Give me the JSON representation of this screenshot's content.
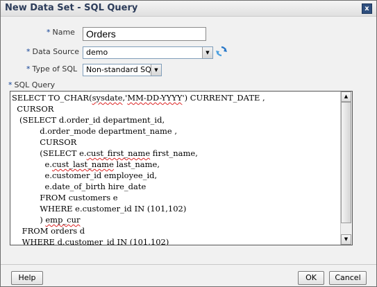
{
  "dialog": {
    "title": "New Data Set - SQL Query",
    "close_label": "x"
  },
  "form": {
    "name": {
      "label": "Name",
      "value": "Orders"
    },
    "data_source": {
      "label": "Data Source",
      "value": "demo"
    },
    "type_of_sql": {
      "label": "Type of SQL",
      "value": "Non-standard SQL"
    },
    "sql_query": {
      "label": "SQL Query",
      "lines": [
        "SELECT TO_CHAR(sysdate,'MM-DD-YYYY') CURRENT_DATE ,",
        "  CURSOR",
        "   (SELECT d.order_id department_id,",
        "           d.order_mode department_name ,",
        "           CURSOR",
        "           (SELECT e.cust_first_name first_name,",
        "             e.cust_last_name last_name,",
        "             e.customer_id employee_id,",
        "             e.date_of_birth hire_date",
        "           FROM customers e",
        "           WHERE e.customer_id IN (101,102)",
        "           ) emp_cur",
        "    FROM orders d",
        "    WHERE d.customer_id IN (101,102)"
      ]
    }
  },
  "required_marker": "*",
  "footer": {
    "help": "Help",
    "ok": "OK",
    "cancel": "Cancel"
  },
  "icons": {
    "refresh": "refresh-icon",
    "close": "close-icon"
  },
  "colors": {
    "title": "#2c3c5a",
    "required": "#0f3f95",
    "close_button": "#2f4f7e"
  }
}
